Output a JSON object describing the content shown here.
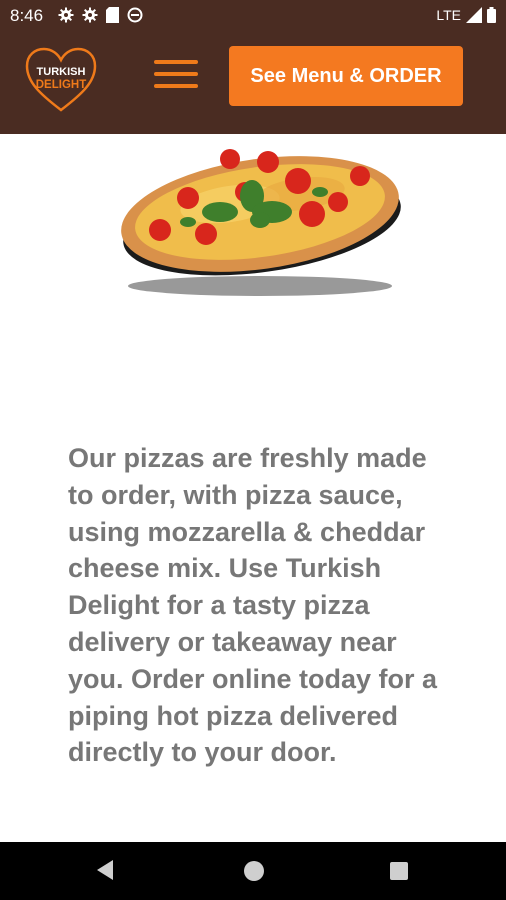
{
  "status_bar": {
    "time": "8:46",
    "network": "LTE",
    "icons_left": [
      "gear-icon",
      "gear-icon",
      "sd-card-icon",
      "no-disturb-icon"
    ],
    "icons_right": [
      "signal-icon",
      "battery-icon"
    ]
  },
  "header": {
    "background_color": "#4a2c22",
    "logo": {
      "line1": "TURKISH",
      "line2": "DELIGHT"
    },
    "menu_icon": "hamburger-menu-icon",
    "order_button_label": "See Menu & ORDER",
    "accent_color": "#f47920"
  },
  "main": {
    "hero_image": "pizza-image",
    "description": "Our pizzas are freshly made to order, with pizza sauce, using mozzarella & cheddar cheese mix. Use Turkish Delight for a tasty pizza delivery or takeaway near you. Order online today for a piping hot pizza delivered directly to your door."
  },
  "nav_bar": {
    "buttons": [
      "back-icon",
      "home-icon",
      "recents-icon"
    ]
  }
}
